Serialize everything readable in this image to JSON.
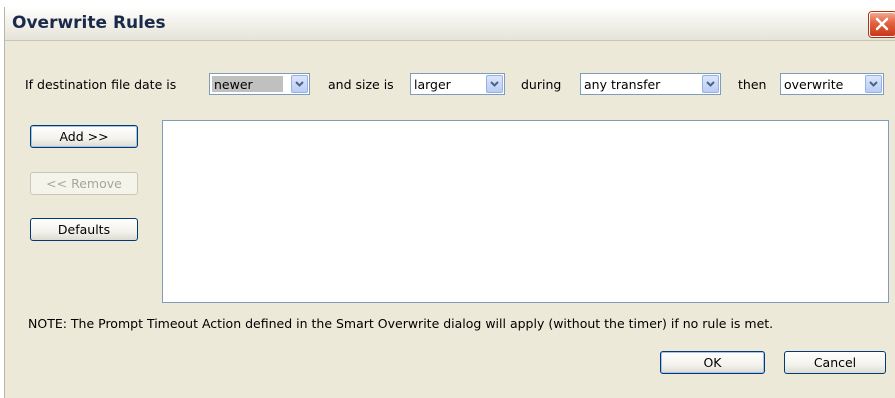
{
  "window": {
    "title": "Overwrite Rules"
  },
  "rule_builder": {
    "label_prefix": "If destination file date is",
    "date_condition": "newer",
    "label_size": "and size is",
    "size_condition": "larger",
    "label_during": "during",
    "transfer_type": "any transfer",
    "label_then": "then",
    "action": "overwrite"
  },
  "buttons": {
    "add": "Add >>",
    "remove": "<< Remove",
    "defaults": "Defaults",
    "ok": "OK",
    "cancel": "Cancel"
  },
  "rules_list": {
    "items": []
  },
  "note": "NOTE: The Prompt Timeout Action defined in the Smart Overwrite dialog will apply (without the timer) if no rule is met.",
  "icons": {
    "close": "close-icon",
    "dropdown": "chevron-down-icon"
  },
  "colors": {
    "dialog_background": "#ece9d8",
    "close_button": "#d9532e",
    "input_border": "#7f9db9",
    "button_border": "#003c74",
    "selected_highlight": "#c0c0c0"
  }
}
